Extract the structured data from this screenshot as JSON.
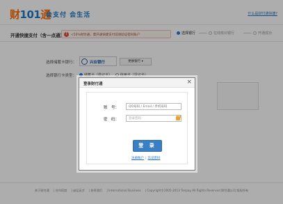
{
  "header": {
    "logo_text_a": "财",
    "logo_text_b": "101",
    "logo_text_c": "通",
    "slogan": "会支付 会生活",
    "top_link": "什么是财付通快捷?"
  },
  "titlebar": {
    "title": "开通快捷支付（含一点通）",
    "notice": "<50%财付通，需开通快捷支付前请验证密码账户",
    "steps": [
      "选择银行",
      "在线核对银行",
      "开通成功"
    ]
  },
  "form": {
    "bank_label": "选择储蓄卡银行：",
    "bank_name": "兴业银行",
    "change_bank": "更换银行 ▾",
    "card_type_label": "选择银行卡类型：",
    "card_type_debit": "储蓄卡（借记卡）",
    "card_type_credit": "信用卡（贷记卡）"
  },
  "footer": {
    "links": [
      "关于财付通",
      "| 合作招商",
      "| 诚征英才",
      "| 联系我们",
      "| International Business",
      "| Copyright©2005-2013 Tenpay All Rights Reserved 财付通公司 版权所有"
    ]
  },
  "modal": {
    "title": "登录财付通",
    "close": "×",
    "account_label": "账　号：",
    "account_placeholder": "QQ号码 / Email / 手机号码",
    "password_label": "密　码：",
    "password_placeholder": "登录密码",
    "login_button": "登 录",
    "register_link": "注册账户",
    "forgot_link": "忘记密码"
  },
  "colors": {
    "brand_orange": "#ff6a00",
    "brand_blue": "#1b7ac8",
    "button_blue": "#3a7fc4"
  }
}
